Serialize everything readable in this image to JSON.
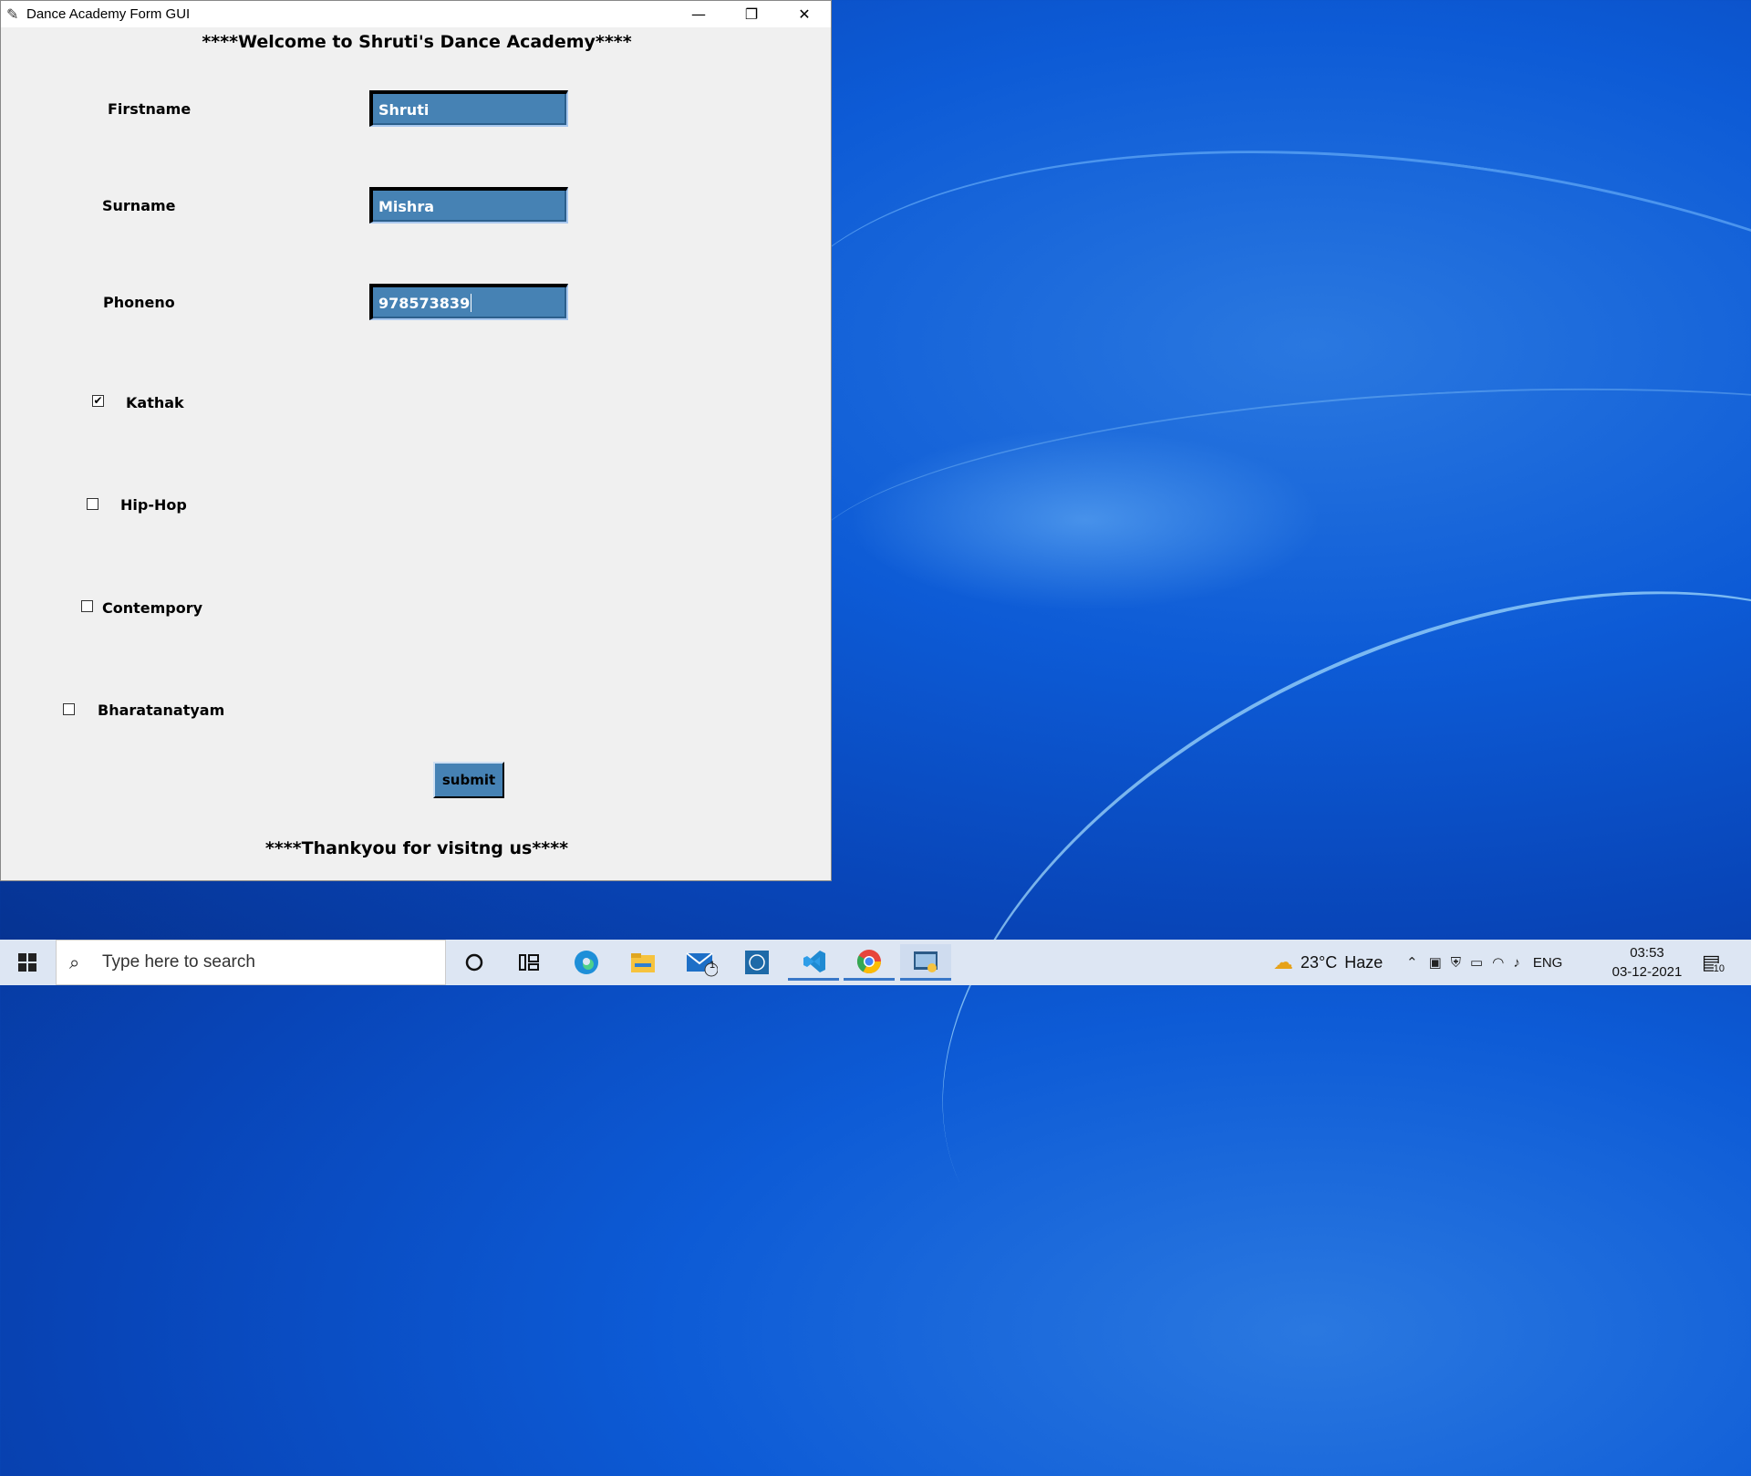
{
  "window": {
    "title": "Dance Academy Form GUI",
    "minimize_glyph": "—",
    "maximize_glyph": "❐",
    "close_glyph": "✕"
  },
  "form": {
    "heading": "****Welcome to Shruti's Dance Academy****",
    "firstname": {
      "label": "Firstname",
      "value": "Shruti"
    },
    "surname": {
      "label": "Surname",
      "value": "Mishra"
    },
    "phoneno": {
      "label": "Phoneno",
      "value": "978573839"
    },
    "checkboxes": [
      {
        "label": "Kathak",
        "checked": true,
        "glyph": "✔"
      },
      {
        "label": "Hip-Hop",
        "checked": false,
        "glyph": ""
      },
      {
        "label": "Contempory",
        "checked": false,
        "glyph": ""
      },
      {
        "label": "Bharatanatyam",
        "checked": false,
        "glyph": ""
      }
    ],
    "submit_label": "submit",
    "footer": "****Thankyou for visitng us****"
  },
  "taskbar": {
    "search_placeholder": "Type here to search",
    "mail_badge": "1",
    "weather_temp": "23°C",
    "weather_desc": "Haze",
    "language": "ENG",
    "time": "03:53",
    "date": "03-12-2021",
    "notifications_count": "10"
  },
  "colors": {
    "entry_bg": "#4682b4",
    "window_bg": "#f0f0f0",
    "desktop_blue": "#0d5bd6"
  }
}
